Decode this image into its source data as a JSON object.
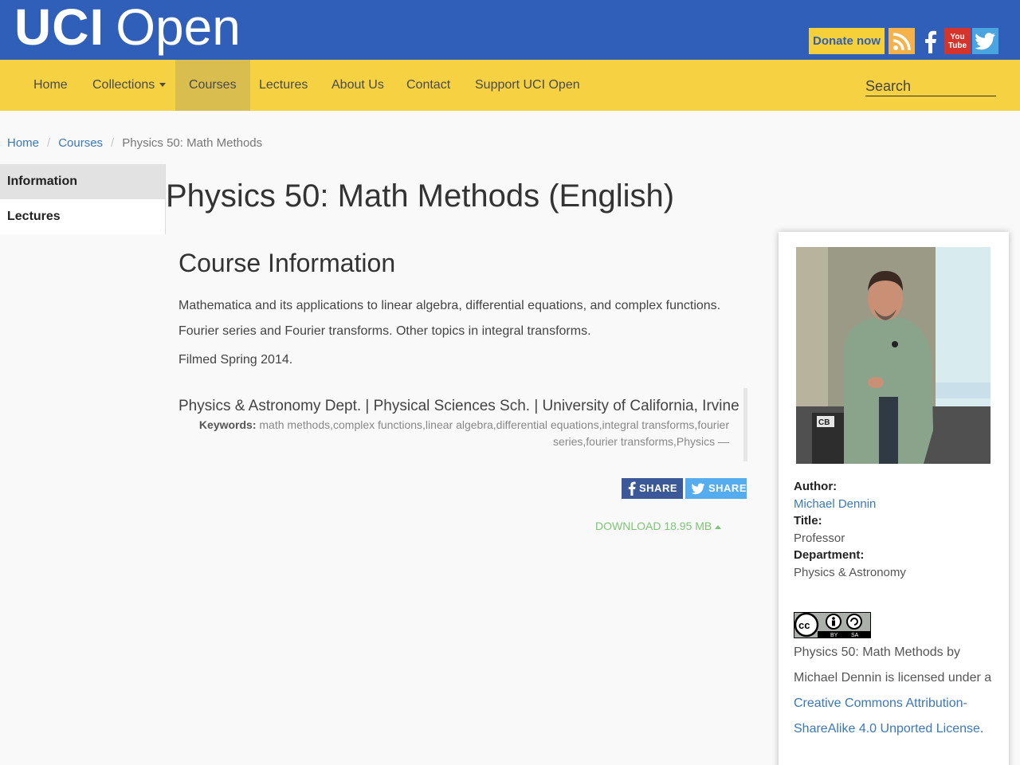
{
  "header": {
    "logo_bold": "UCI",
    "logo_light": "Open",
    "donate_label": "Donate now",
    "youtube_text_top": "You",
    "youtube_text_bottom": "Tube"
  },
  "nav": {
    "items": [
      "Home",
      "Collections",
      "Courses",
      "Lectures",
      "About Us",
      "Contact",
      "Support UCI Open"
    ],
    "active": "Courses",
    "search_placeholder": "Search"
  },
  "breadcrumb": {
    "home": "Home",
    "courses": "Courses",
    "current": "Physics 50: Math Methods"
  },
  "sidetabs": {
    "information": "Information",
    "lectures": "Lectures"
  },
  "main": {
    "page_title": "Physics 50: Math Methods (English)",
    "section_title": "Course Information",
    "description": "Mathematica and its applications to linear algebra, differential equations, and complex functions. Fourier series and Fourier transforms. Other topics in integral transforms.",
    "filmed": "Filmed Spring 2014.",
    "dept_line": "Physics & Astronomy Dept. | Physical Sciences Sch. | University of California, Irvine",
    "keywords_label": "Keywords:",
    "keywords": "math methods,complex functions,linear algebra,differential equations,integral transforms,fourier series,fourier transforms,Physics —",
    "share_facebook": "SHARE",
    "share_twitter": "SHARE",
    "download": "DOWNLOAD 18.95 MB"
  },
  "panel": {
    "author_label": "Author:",
    "author": "Michael Dennin",
    "title_label": "Title:",
    "title": "Professor",
    "department_label": "Department:",
    "department": "Physics & Astronomy",
    "cc_by": "BY",
    "cc_sa": "SA",
    "photo_sign": "CB",
    "license_prefix": "Physics 50: Math Methods by Michael Dennin is licensed under a ",
    "license_link": "Creative Commons Attribution-ShareAlike 4.0 Unported License",
    "license_suffix": "."
  },
  "colors": {
    "header_blue": "#2f5fb8",
    "nav_yellow": "#f6d243",
    "link_blue": "#3a78b8",
    "download_green": "#7cc576"
  }
}
